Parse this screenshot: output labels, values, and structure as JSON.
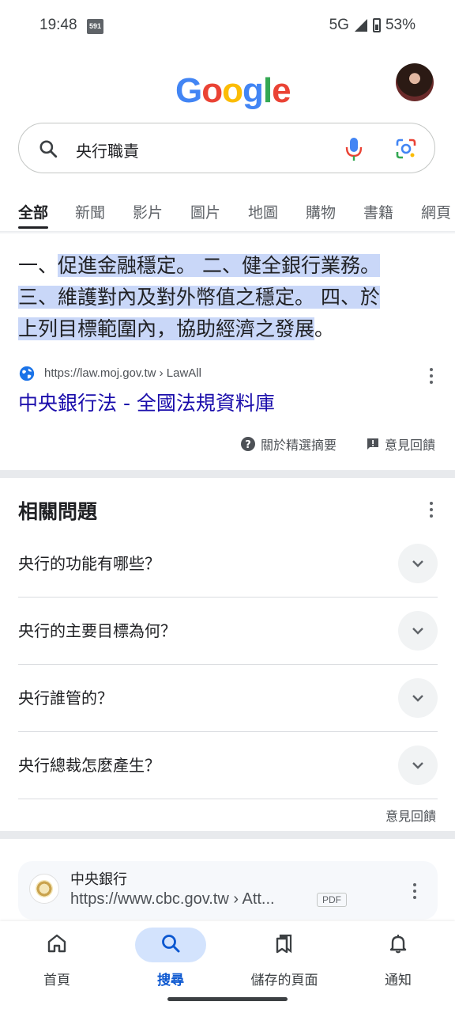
{
  "status_bar": {
    "time": "19:48",
    "badge": "591",
    "network": "5G",
    "battery": "53%"
  },
  "header": {
    "logo": [
      "G",
      "o",
      "o",
      "g",
      "l",
      "e"
    ],
    "logo_colors": [
      "#4285F4",
      "#EA4335",
      "#FBBC05",
      "#4285F4",
      "#34A853",
      "#EA4335"
    ]
  },
  "search": {
    "query": "央行職責"
  },
  "tabs": [
    "全部",
    "新聞",
    "影片",
    "圖片",
    "地圖",
    "購物",
    "書籍",
    "網頁"
  ],
  "snippet": {
    "prefix": "一、",
    "highlight1": "促進金融穩定。 二、健全銀行業務。",
    "highlight2": "三、維護對內及對外幣值之穩定。 四、於",
    "highlight3": "上列目標範圍內，協助經濟之發展",
    "suffix": "。",
    "source_url": "https://law.moj.gov.tw › LawAll",
    "source_title": "中央銀行法 - 全國法規資料庫",
    "about_label": "關於精選摘要",
    "feedback_label": "意見回饋"
  },
  "related": {
    "title": "相關問題",
    "questions": [
      "央行的功能有哪些？",
      "央行的主要目標為何？",
      "央行誰管的？",
      "央行總裁怎麼產生？"
    ],
    "feedback_label": "意見回饋"
  },
  "result": {
    "site": "中央銀行",
    "url": "https://www.cbc.gov.tw › Att...",
    "tag": "PDF"
  },
  "bottom_nav": {
    "items": [
      "首頁",
      "搜尋",
      "儲存的頁面",
      "通知"
    ],
    "active": "搜尋"
  },
  "colors": {
    "accent": "#0b57d0",
    "link": "#1a0dab",
    "highlight": "#c9d7f8"
  }
}
